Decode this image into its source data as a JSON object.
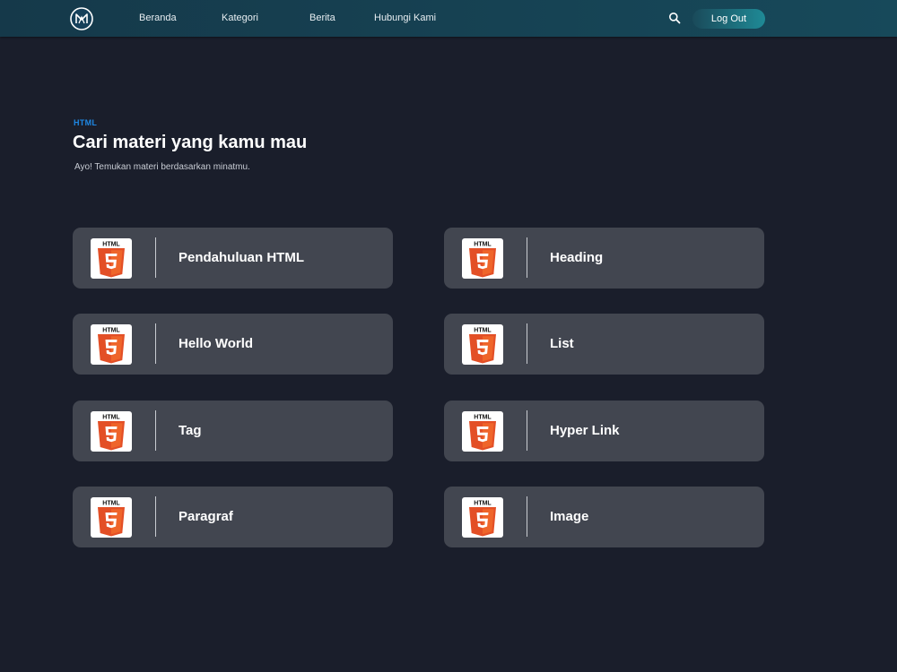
{
  "nav": {
    "logo_icon": "ma-monogram-logo-icon",
    "links": [
      "Beranda",
      "Kategori",
      "Berita",
      "Hubungi Kami"
    ],
    "search_icon": "search-icon",
    "logout_label": "Log Out"
  },
  "header": {
    "eyebrow": "HTML",
    "title": "Cari materi yang kamu mau",
    "subtitle": "Ayo! Temukan materi berdasarkan minatmu."
  },
  "cards": [
    {
      "label": "Pendahuluan HTML",
      "icon": "html5-icon",
      "badge": "HTML"
    },
    {
      "label": "Heading",
      "icon": "html5-icon",
      "badge": "HTML"
    },
    {
      "label": "Hello World",
      "icon": "html5-icon",
      "badge": "HTML"
    },
    {
      "label": "List",
      "icon": "html5-icon",
      "badge": "HTML"
    },
    {
      "label": "Tag",
      "icon": "html5-icon",
      "badge": "HTML"
    },
    {
      "label": "Hyper Link",
      "icon": "html5-icon",
      "badge": "HTML"
    },
    {
      "label": "Paragraf",
      "icon": "html5-icon",
      "badge": "HTML"
    },
    {
      "label": "Image",
      "icon": "html5-icon",
      "badge": "HTML"
    }
  ],
  "colors": {
    "background": "#1a1e2b",
    "navbar": "#15394a",
    "accent": "#1e88e5",
    "card": "#424650",
    "html5_orange": "#e34f26"
  }
}
